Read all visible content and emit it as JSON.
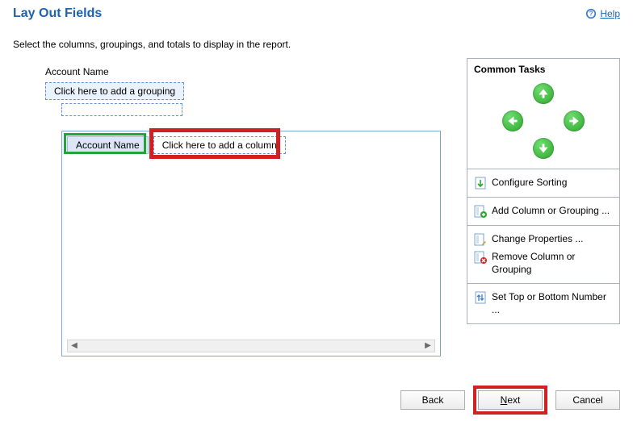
{
  "header": {
    "title": "Lay Out Fields",
    "help": "Help"
  },
  "instructions": "Select the columns, groupings, and totals to display in the report.",
  "grouping": {
    "label": "Account Name",
    "placeholder": "Click here to add a grouping"
  },
  "canvas": {
    "column_selected": "Account Name",
    "column_placeholder": "Click here to add a column"
  },
  "tasks": {
    "title": "Common Tasks",
    "configure_sorting": "Configure Sorting",
    "add_column": "Add Column or Grouping ...",
    "change_properties": "Change Properties ...",
    "remove_column": "Remove Column or Grouping",
    "set_top_bottom": "Set Top or Bottom Number ..."
  },
  "footer": {
    "back": "Back",
    "next": "Next",
    "cancel": "Cancel"
  }
}
